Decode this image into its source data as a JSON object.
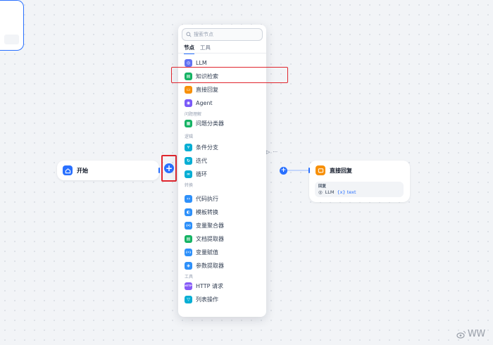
{
  "colors": {
    "accent": "#2970ff",
    "highlight_border": "#e0262e",
    "canvas_bg": "#f2f4f7"
  },
  "start_node": {
    "title": "开始",
    "icon": "home-icon"
  },
  "llm_node": {
    "toolbar_icons": [
      "play-icon",
      "more-icon"
    ]
  },
  "reply_node": {
    "title": "直接回复",
    "field_label": "回复",
    "value_source": "LLM",
    "value_var": "{x} text"
  },
  "add_button": {
    "label": "+"
  },
  "node_picker": {
    "search_placeholder": "搜索节点",
    "tabs": [
      "节点",
      "工具"
    ],
    "active_tab": "节点",
    "items": [
      {
        "label": "LLM",
        "icon": "llm-icon",
        "color": "#6172f3",
        "glyph": "◎"
      },
      {
        "label": "知识检索",
        "icon": "knowledge-retrieval-icon",
        "color": "#16b364",
        "glyph": "▤",
        "highlighted": true
      },
      {
        "label": "直接回复",
        "icon": "direct-reply-icon",
        "color": "#f79009",
        "glyph": "▭"
      },
      {
        "label": "Agent",
        "icon": "agent-icon",
        "color": "#7a5af8",
        "glyph": "◉"
      },
      {
        "group": "问题理解"
      },
      {
        "label": "问题分类器",
        "icon": "question-classifier-icon",
        "color": "#16b364",
        "glyph": "▦"
      },
      {
        "group": "逻辑"
      },
      {
        "label": "条件分支",
        "icon": "if-else-icon",
        "color": "#06aed4",
        "glyph": "⑂"
      },
      {
        "label": "迭代",
        "icon": "iteration-icon",
        "color": "#06aed4",
        "glyph": "↻"
      },
      {
        "label": "循环",
        "icon": "loop-icon",
        "color": "#06aed4",
        "glyph": "∞"
      },
      {
        "group": "转换"
      },
      {
        "label": "代码执行",
        "icon": "code-icon",
        "color": "#2e90fa",
        "glyph": "‹›"
      },
      {
        "label": "模板转换",
        "icon": "template-icon",
        "color": "#2e90fa",
        "glyph": "◐"
      },
      {
        "label": "变量聚合器",
        "icon": "variable-aggregator-icon",
        "color": "#2e90fa",
        "glyph": "{x}"
      },
      {
        "label": "文档提取器",
        "icon": "doc-extractor-icon",
        "color": "#16b364",
        "glyph": "▤"
      },
      {
        "label": "变量赋值",
        "icon": "variable-assigner-icon",
        "color": "#2e90fa",
        "glyph": "{=}"
      },
      {
        "label": "参数提取器",
        "icon": "parameter-extractor-icon",
        "color": "#2e90fa",
        "glyph": "◈"
      },
      {
        "group": "工具"
      },
      {
        "label": "HTTP 请求",
        "icon": "http-request-icon",
        "color": "#875bf7",
        "glyph": "HTTP"
      },
      {
        "label": "列表操作",
        "icon": "list-operator-icon",
        "color": "#06aed4",
        "glyph": "▽"
      }
    ]
  },
  "watermark": {
    "text": "WW",
    "icon": "weibo-logo-icon"
  }
}
